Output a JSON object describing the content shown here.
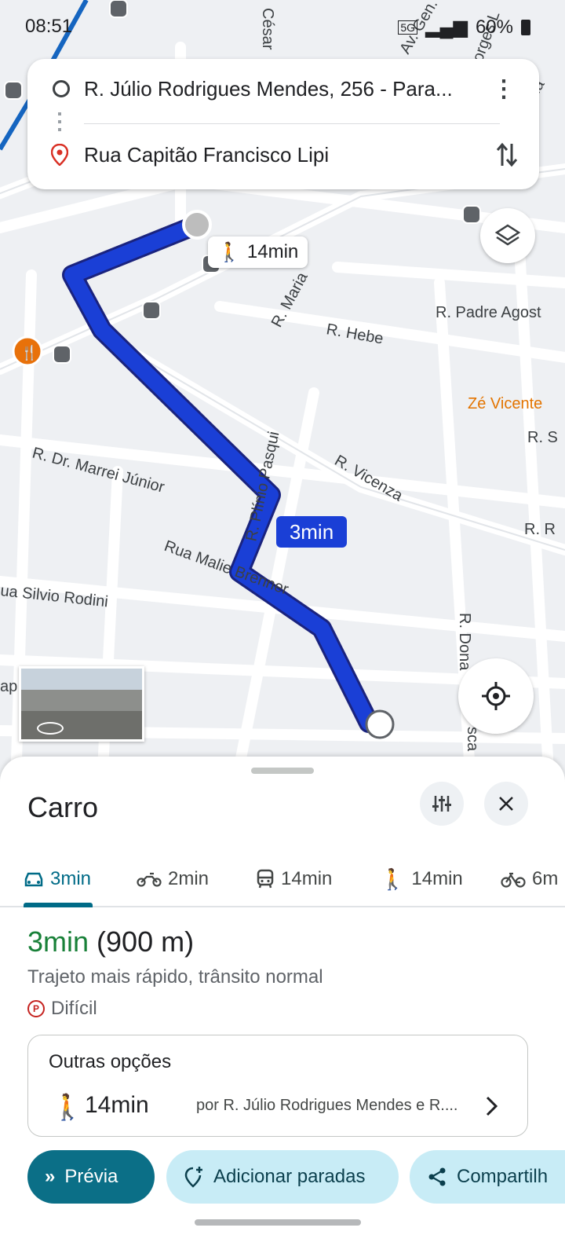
{
  "status_bar": {
    "time": "08:51",
    "network": "5G",
    "battery": "60%"
  },
  "directions": {
    "origin": "R. Júlio Rodrigues Mendes, 256 - Para...",
    "destination": "Rua Capitão Francisco Lipi"
  },
  "map": {
    "walk_bubble": "14min",
    "route_badge": "3min",
    "streets": {
      "cesar": "César",
      "maria": "R. Maria",
      "padre": "R. Padre Agost",
      "hebe": "R. Hebe",
      "ze_vicente": "Zé Vicente",
      "r_s": "R. S",
      "r_r": "R. R",
      "marrei": "R. Dr. Marrei Júnior",
      "vicenza": "R. Vicenza",
      "plinio": "R. Plínio Pasqui",
      "malie": "Rua Malie Brenner",
      "silvio": "ua Silvio Rodini",
      "dona": "R. Dona",
      "sca": "sca",
      "ap": "ap",
      "av_gen": "Av. Gen.",
      "gada": "gada",
      "org": "orges L"
    }
  },
  "sheet": {
    "title": "Carro",
    "modes": [
      {
        "icon": "car-icon",
        "label": "3min"
      },
      {
        "icon": "motorcycle-icon",
        "label": "2min"
      },
      {
        "icon": "transit-icon",
        "label": "14min"
      },
      {
        "icon": "walk-icon",
        "label": "14min"
      },
      {
        "icon": "bike-icon",
        "label": "6m"
      }
    ],
    "summary_time": "3min",
    "summary_distance": "(900 m)",
    "summary_desc": "Trajeto mais rápido, trânsito normal",
    "parking": "Difícil",
    "other_options": {
      "title": "Outras opções",
      "time": "14min",
      "route": "por R. Júlio Rodrigues Mendes e R...."
    },
    "buttons": {
      "preview": "Prévia",
      "add_stops": "Adicionar paradas",
      "share": "Compartilh"
    }
  },
  "colors": {
    "route": "#1a3fd6",
    "accent": "#006b87",
    "green": "#188038"
  }
}
